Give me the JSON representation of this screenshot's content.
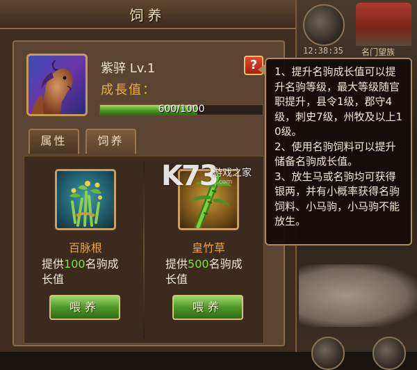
{
  "panel": {
    "title": "饲养"
  },
  "horse": {
    "name": "紫骍 Lv.1",
    "growth_label": "成長值：",
    "progress_text": "600/1000",
    "progress_current": 600,
    "progress_max": 1000
  },
  "help_button": {
    "label": "?"
  },
  "tabs": [
    {
      "label": "属性",
      "active": false
    },
    {
      "label": "饲养",
      "active": true
    }
  ],
  "items": [
    {
      "name": "百脉根",
      "desc_prefix": "提供",
      "desc_value": "100",
      "desc_suffix_line1": "名驹成",
      "desc_line2": "长值",
      "button_label": "喂养",
      "icon": "herb-icon"
    },
    {
      "name": "皇竹草",
      "desc_prefix": "提供",
      "desc_value": "500",
      "desc_suffix_line1": "名驹成",
      "desc_line2": "长值",
      "button_label": "喂养",
      "icon": "bamboo-grass-icon"
    }
  ],
  "tooltip": {
    "lines": [
      "1、提升名驹成长值可以提升名驹等级，最大等级随官职提升，县令1级，郡守4级，刺史7级，州牧及以上10级。",
      "2、使用名驹饲料可以提升储备名驹成长值。",
      "3、放生马或名驹均可获得银两，并有小概率获得名驹饲料、小马驹，小马驹不能放生。"
    ]
  },
  "background": {
    "clock": "12:38:35",
    "building_label": "名门望族"
  },
  "watermark": {
    "logo": "K73",
    "text": "游戏之家",
    "domain": ".com"
  },
  "colors": {
    "progress": "#4f9a24",
    "item_name": "#e8a640",
    "highlight_value": "#7fe040",
    "title": "#f2e1b8"
  }
}
